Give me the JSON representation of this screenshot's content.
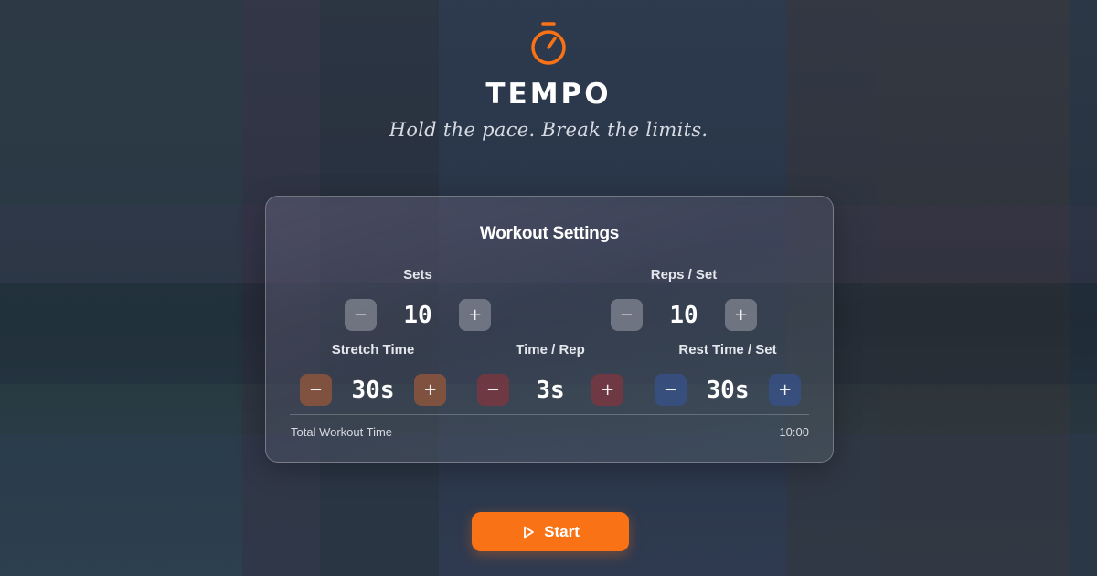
{
  "app": {
    "title": "TEMPO",
    "tagline": "Hold the pace. Break the limits.",
    "logo_icon": "stopwatch-icon",
    "accent_color": "#f97316"
  },
  "settings": {
    "title": "Workout Settings",
    "decrement_symbol": "−",
    "increment_symbol": "+",
    "sets": {
      "label": "Sets",
      "value": "10"
    },
    "reps": {
      "label": "Reps / Set",
      "value": "10"
    },
    "stretch": {
      "label": "Stretch Time",
      "value": "30s",
      "color": "#8c553c"
    },
    "time_per_rep": {
      "label": "Time / Rep",
      "value": "3s",
      "color": "#783741"
    },
    "rest": {
      "label": "Rest Time / Set",
      "value": "30s",
      "color": "#375082"
    },
    "total": {
      "label": "Total Workout Time",
      "value": "10:00"
    }
  },
  "start": {
    "label": "Start",
    "icon": "play-icon"
  }
}
